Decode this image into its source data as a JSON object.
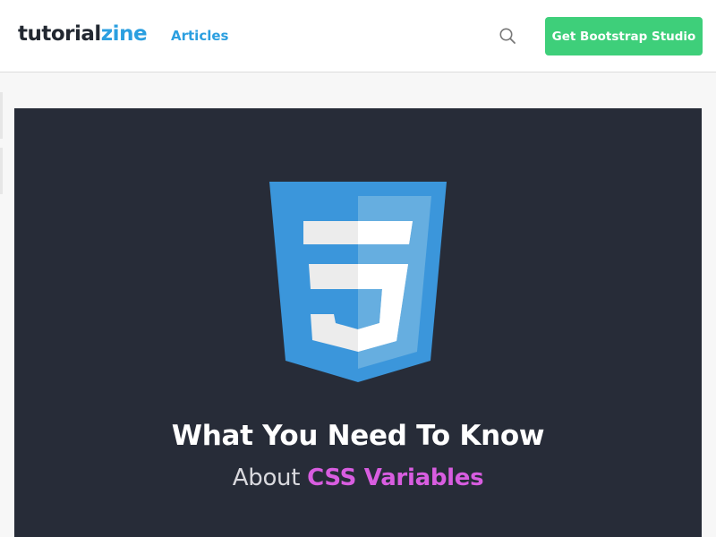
{
  "header": {
    "logo_part1": "tutorial",
    "logo_part2": "zine",
    "nav_articles": "Articles",
    "search_icon": "search-icon",
    "cta_label": "Get Bootstrap Studio"
  },
  "hero": {
    "image_icon": "css3-logo",
    "title": "What You Need To Know",
    "subtitle_prefix": "About",
    "subtitle_highlight": "CSS Variables"
  },
  "colors": {
    "brand_dark": "#222831",
    "brand_blue": "#2b9fe0",
    "cta_green": "#3ecf7a",
    "hero_bg": "#272c38",
    "accent_pink": "#d85de0",
    "css3_blue": "#3b96db"
  }
}
